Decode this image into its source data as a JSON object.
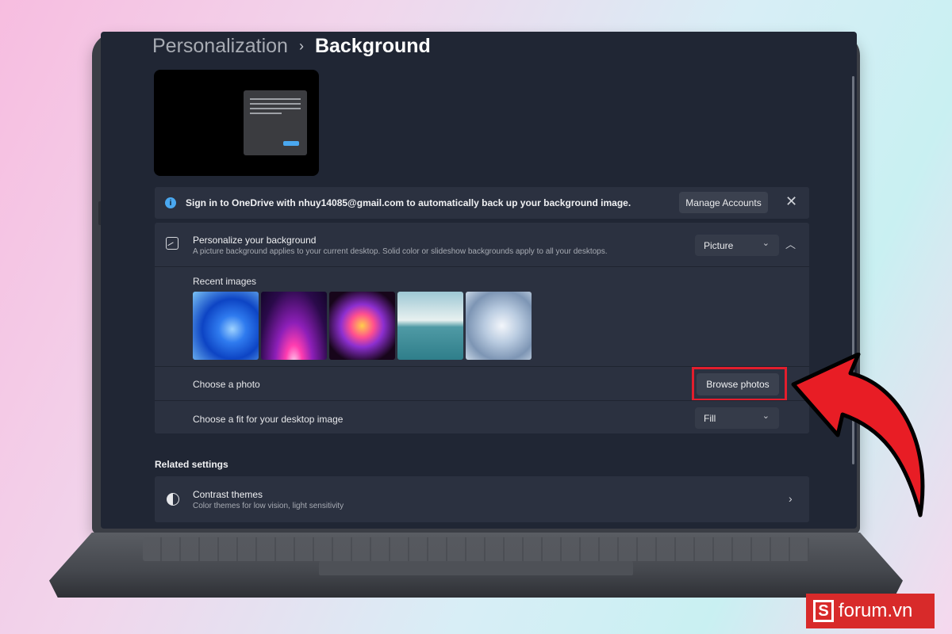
{
  "breadcrumb": {
    "parent": "Personalization",
    "separator": "›",
    "current": "Background"
  },
  "onedrive_banner": {
    "icon": "info-icon",
    "text": "Sign in to OneDrive with nhuy14085@gmail.com to automatically back up your background image.",
    "button_label": "Manage Accounts",
    "close_symbol": "✕"
  },
  "personalize": {
    "icon": "picture-icon",
    "title": "Personalize your background",
    "subtitle": "A picture background applies to your current desktop. Solid color or slideshow backgrounds apply to all your desktops.",
    "selected_value": "Picture",
    "recent_label": "Recent images",
    "recent_images": [
      "bloom-blue",
      "glow-purple",
      "ribbon-colorful",
      "lake-sunrise",
      "bloom-white"
    ],
    "choose_photo_label": "Choose a photo",
    "browse_label": "Browse photos",
    "fit_label": "Choose a fit for your desktop image",
    "fit_value": "Fill"
  },
  "related": {
    "heading": "Related settings",
    "contrast_title": "Contrast themes",
    "contrast_subtitle": "Color themes for low vision, light sensitivity"
  },
  "colors": {
    "accent": "#4aa8f0",
    "highlight": "#e31e2d",
    "screen_bg": "#202634"
  },
  "watermark": {
    "mark": "S",
    "text": "forum.vn"
  }
}
